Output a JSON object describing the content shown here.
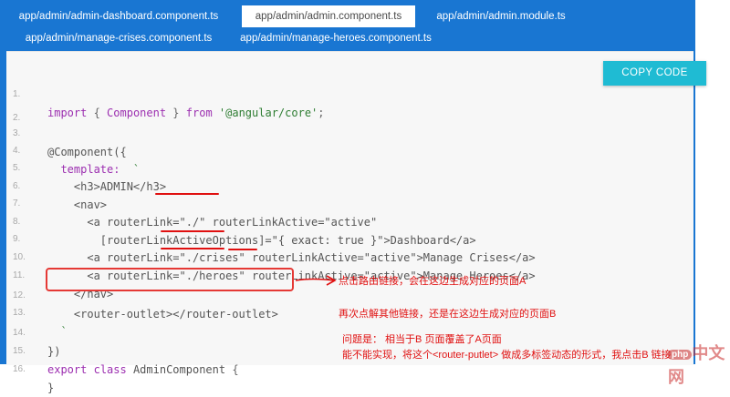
{
  "tabs": [
    {
      "label": "app/admin/admin-dashboard.component.ts",
      "active": false
    },
    {
      "label": "app/admin/admin.component.ts",
      "active": true
    },
    {
      "label": "app/admin/admin.module.ts",
      "active": false
    },
    {
      "label": "app/admin/manage-crises.component.ts",
      "active": false
    },
    {
      "label": "app/admin/manage-heroes.component.ts",
      "active": false
    }
  ],
  "copy_button": {
    "label": "COPY CODE"
  },
  "code": {
    "line_numbers": [
      "1.",
      "2.",
      "3.",
      "4.",
      "5.",
      "6.",
      "7.",
      "8.",
      "9.",
      "10.",
      "11.",
      "12.",
      "13.",
      "14.",
      "15.",
      "16."
    ],
    "l1": {
      "kw1": "import",
      "p1": " { ",
      "id": "Component",
      "p2": " } ",
      "kw2": "from",
      "sp": " ",
      "str": "'@angular/core'",
      "p3": ";"
    },
    "l3": "@Component({",
    "l4": {
      "key": "  template:",
      "tick": "  `"
    },
    "l5": "    <h3>ADMIN</h3>",
    "l6": "    <nav>",
    "l7": "      <a routerLink=\"./\" routerLinkActive=\"active\"",
    "l8": "        [routerLinkActiveOptions]=\"{ exact: true }\">Dashboard</a>",
    "l9": "      <a routerLink=\"./crises\" routerLinkActive=\"active\">Manage Crises</a>",
    "l10": "      <a routerLink=\"./heroes\" routerLinkActive=\"active\">Manage Heroes</a>",
    "l11": "    </nav>",
    "l12": "    <router-outlet></router-outlet>",
    "l13": "  `",
    "l14": "})",
    "l15": {
      "kw1": "export",
      "sp1": " ",
      "kw2": "class",
      "sp2": " ",
      "id": "AdminComponent",
      "p": " {"
    },
    "l16": "}"
  },
  "annotations": {
    "a1": "点击路由链接，会在这边生成对应的页面A",
    "a2": "再次点解其他链接，还是在这边生成对应的页面B",
    "a3": "问题是：  相当于B 页面覆盖了A页面",
    "a4": "能不能实现，将这个<router-putlet> 做成多标签动态的形式，我点击B 链接"
  },
  "watermark": {
    "badge": "php",
    "text": "中文网"
  },
  "colors": {
    "frame_blue": "#1976d2",
    "copy_button": "#1fbbd3",
    "annotation_red": "#e01010"
  }
}
